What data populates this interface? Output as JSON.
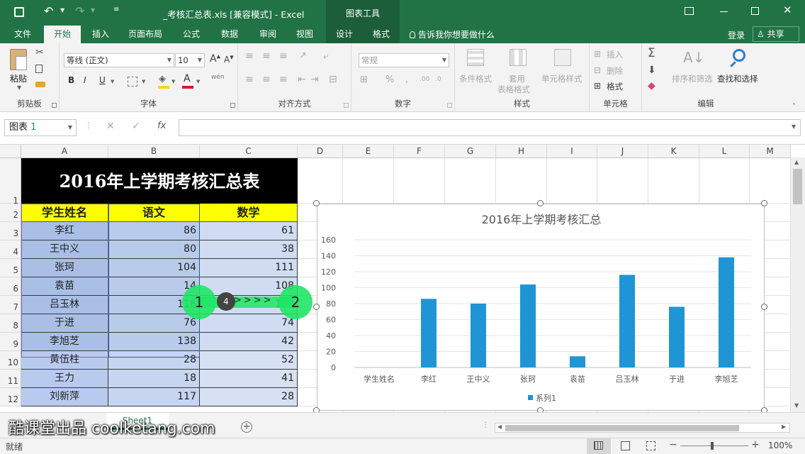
{
  "title_bar": {
    "window_title": "_考核汇总表.xls  [兼容模式] - Excel",
    "chart_tools": "图表工具",
    "login": "登录",
    "share": "共享"
  },
  "tabs": [
    "文件",
    "开始",
    "插入",
    "页面布局",
    "公式",
    "数据",
    "审阅",
    "视图",
    "设计",
    "格式"
  ],
  "tell_me": "告诉我你想要做什么",
  "ribbon": {
    "clipboard": {
      "paste": "粘贴",
      "label": "剪贴板"
    },
    "font": {
      "name": "等线 (正文)",
      "size": "10",
      "bold": "B",
      "italic": "I",
      "underline": "U",
      "wen": "wén",
      "label": "字体"
    },
    "alignment": {
      "label": "对齐方式"
    },
    "number": {
      "format": "常规",
      "percent": "%",
      "label": "数字"
    },
    "styles": {
      "cond": "条件格式",
      "table1": "套用",
      "table2": "表格格式",
      "cell": "单元格样式",
      "label": "样式"
    },
    "cells": {
      "insert": "插入",
      "delete": "删除",
      "format": "格式",
      "label": "单元格"
    },
    "editing": {
      "sort": "排序和筛选",
      "find": "查找和选择",
      "label": "编辑"
    }
  },
  "formula_bar": {
    "name_box_text": "图表",
    "name_box_num": "1",
    "fx": "fx",
    "value": ""
  },
  "sheet": {
    "columns": [
      "A",
      "B",
      "C",
      "D",
      "E",
      "F",
      "G",
      "H",
      "I",
      "J",
      "K",
      "L",
      "M"
    ],
    "row_numbers": [
      "1",
      "2",
      "3",
      "4",
      "5",
      "6",
      "7",
      "8",
      "9",
      "10",
      "11",
      "12"
    ],
    "title": "2016年上学期考核汇总表",
    "headers": [
      "学生姓名",
      "语文",
      "数学"
    ],
    "rows": [
      [
        "李红",
        "86",
        "61"
      ],
      [
        "王中义",
        "80",
        "38"
      ],
      [
        "张珂",
        "104",
        "111"
      ],
      [
        "袁苗",
        "14",
        "108"
      ],
      [
        "吕玉林",
        "116",
        "120"
      ],
      [
        "于进",
        "76",
        "74"
      ],
      [
        "李旭芝",
        "138",
        "42"
      ],
      [
        "黄伍柱",
        "28",
        "52"
      ],
      [
        "王力",
        "18",
        "41"
      ],
      [
        "刘新萍",
        "117",
        "28"
      ]
    ]
  },
  "overlay": {
    "left": "1",
    "right": "2",
    "mid": "4",
    "arrows": ">>>>"
  },
  "chart_data": {
    "type": "bar",
    "title": "2016年上学期考核汇总",
    "categories": [
      "学生姓名",
      "李红",
      "王中义",
      "张珂",
      "袁苗",
      "吕玉林",
      "于进",
      "李旭芝"
    ],
    "series": [
      {
        "name": "系列1",
        "values": [
          0,
          86,
          80,
          104,
          14,
          116,
          76,
          138
        ]
      }
    ],
    "yticks": [
      "0",
      "20",
      "40",
      "60",
      "80",
      "100",
      "120",
      "140",
      "160"
    ],
    "ylim": [
      0,
      160
    ],
    "color": "#1f95d5",
    "legend": "bottom"
  },
  "sheet_tab": "Sheet1",
  "watermark": "酷课堂出品 coolketang.com",
  "status": {
    "ready": "就绪",
    "zoom": "100%"
  }
}
